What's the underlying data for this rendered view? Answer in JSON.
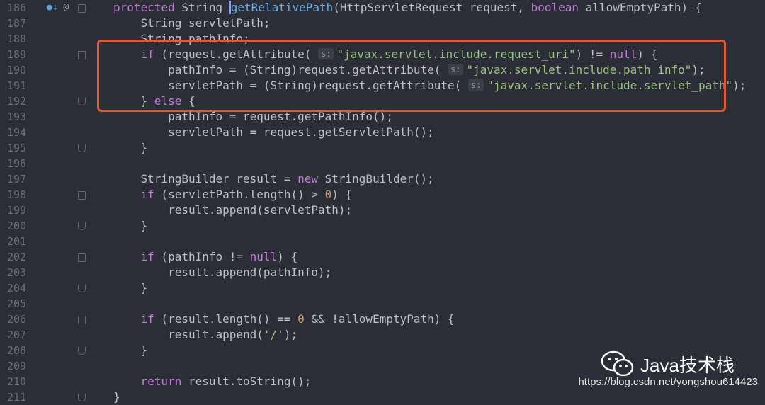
{
  "gutter": {
    "icons": [
      "override-icon",
      "annotation-icon"
    ]
  },
  "lines": [
    {
      "num": "186",
      "tokens": [
        [
          "kw",
          "protected "
        ],
        [
          "",
          "String "
        ],
        [
          "caret",
          ""
        ],
        [
          "fn",
          "getRelativePath"
        ],
        [
          "",
          "(HttpServletRequest request, "
        ],
        [
          "kw",
          "boolean"
        ],
        [
          "",
          " allowEmptyPath) {"
        ]
      ]
    },
    {
      "num": "187",
      "tokens": [
        [
          "",
          "    String servletPath;"
        ]
      ]
    },
    {
      "num": "188",
      "tokens": [
        [
          "",
          "    String pathInfo;"
        ]
      ]
    },
    {
      "num": "189",
      "tokens": [
        [
          "",
          "    "
        ],
        [
          "kw",
          "if"
        ],
        [
          "",
          " (request.getAttribute( "
        ],
        [
          "hint",
          "s:"
        ],
        [
          "str",
          "\"javax.servlet.include.request_uri\""
        ],
        [
          "",
          ") != "
        ],
        [
          "kw",
          "null"
        ],
        [
          "",
          ") {"
        ]
      ]
    },
    {
      "num": "190",
      "tokens": [
        [
          "",
          "        pathInfo = (String)request.getAttribute( "
        ],
        [
          "hint",
          "s:"
        ],
        [
          "str",
          "\"javax.servlet.include.path_info\""
        ],
        [
          "",
          ");"
        ]
      ]
    },
    {
      "num": "191",
      "tokens": [
        [
          "",
          "        servletPath = (String)request.getAttribute( "
        ],
        [
          "hint",
          "s:"
        ],
        [
          "str",
          "\"javax.servlet.include.servlet_path\""
        ],
        [
          "",
          ");"
        ]
      ]
    },
    {
      "num": "192",
      "tokens": [
        [
          "",
          "    } "
        ],
        [
          "kw",
          "else"
        ],
        [
          "",
          " {"
        ]
      ]
    },
    {
      "num": "193",
      "tokens": [
        [
          "",
          "        pathInfo = request.getPathInfo();"
        ]
      ]
    },
    {
      "num": "194",
      "tokens": [
        [
          "",
          "        servletPath = request.getServletPath();"
        ]
      ]
    },
    {
      "num": "195",
      "tokens": [
        [
          "",
          "    }"
        ]
      ]
    },
    {
      "num": "196",
      "tokens": []
    },
    {
      "num": "197",
      "tokens": [
        [
          "",
          "    StringBuilder result = "
        ],
        [
          "kw",
          "new"
        ],
        [
          "",
          " StringBuilder();"
        ]
      ]
    },
    {
      "num": "198",
      "tokens": [
        [
          "",
          "    "
        ],
        [
          "kw",
          "if"
        ],
        [
          "",
          " (servletPath.length() > "
        ],
        [
          "num",
          "0"
        ],
        [
          "",
          ") {"
        ]
      ]
    },
    {
      "num": "199",
      "tokens": [
        [
          "",
          "        result.append(servletPath);"
        ]
      ]
    },
    {
      "num": "200",
      "tokens": [
        [
          "",
          "    }"
        ]
      ]
    },
    {
      "num": "201",
      "tokens": []
    },
    {
      "num": "202",
      "tokens": [
        [
          "",
          "    "
        ],
        [
          "kw",
          "if"
        ],
        [
          "",
          " (pathInfo != "
        ],
        [
          "kw",
          "null"
        ],
        [
          "",
          ") {"
        ]
      ]
    },
    {
      "num": "203",
      "tokens": [
        [
          "",
          "        result.append(pathInfo);"
        ]
      ]
    },
    {
      "num": "204",
      "tokens": [
        [
          "",
          "    }"
        ]
      ]
    },
    {
      "num": "205",
      "tokens": []
    },
    {
      "num": "206",
      "tokens": [
        [
          "",
          "    "
        ],
        [
          "kw",
          "if"
        ],
        [
          "",
          " (result.length() == "
        ],
        [
          "num",
          "0"
        ],
        [
          "",
          " && !allowEmptyPath) {"
        ]
      ]
    },
    {
      "num": "207",
      "tokens": [
        [
          "",
          "        result.append("
        ],
        [
          "str",
          "'/'"
        ],
        [
          "",
          ");"
        ]
      ]
    },
    {
      "num": "208",
      "tokens": [
        [
          "",
          "    }"
        ]
      ]
    },
    {
      "num": "209",
      "tokens": []
    },
    {
      "num": "210",
      "tokens": [
        [
          "",
          "    "
        ],
        [
          "kw",
          "return"
        ],
        [
          "",
          " result.toString();"
        ]
      ]
    },
    {
      "num": "211",
      "tokens": [
        [
          "",
          "}"
        ]
      ]
    }
  ],
  "folds": {
    "start": [
      "186",
      "189",
      "198",
      "202",
      "206"
    ],
    "end": [
      "192",
      "195",
      "200",
      "204",
      "208",
      "211"
    ],
    "mid": [
      "192"
    ]
  },
  "watermark": {
    "brand": "Java技术栈",
    "url": "https://blog.csdn.net/yongshou614423"
  },
  "colors": {
    "highlight": "#e8572e",
    "background": "#2b2e36"
  }
}
